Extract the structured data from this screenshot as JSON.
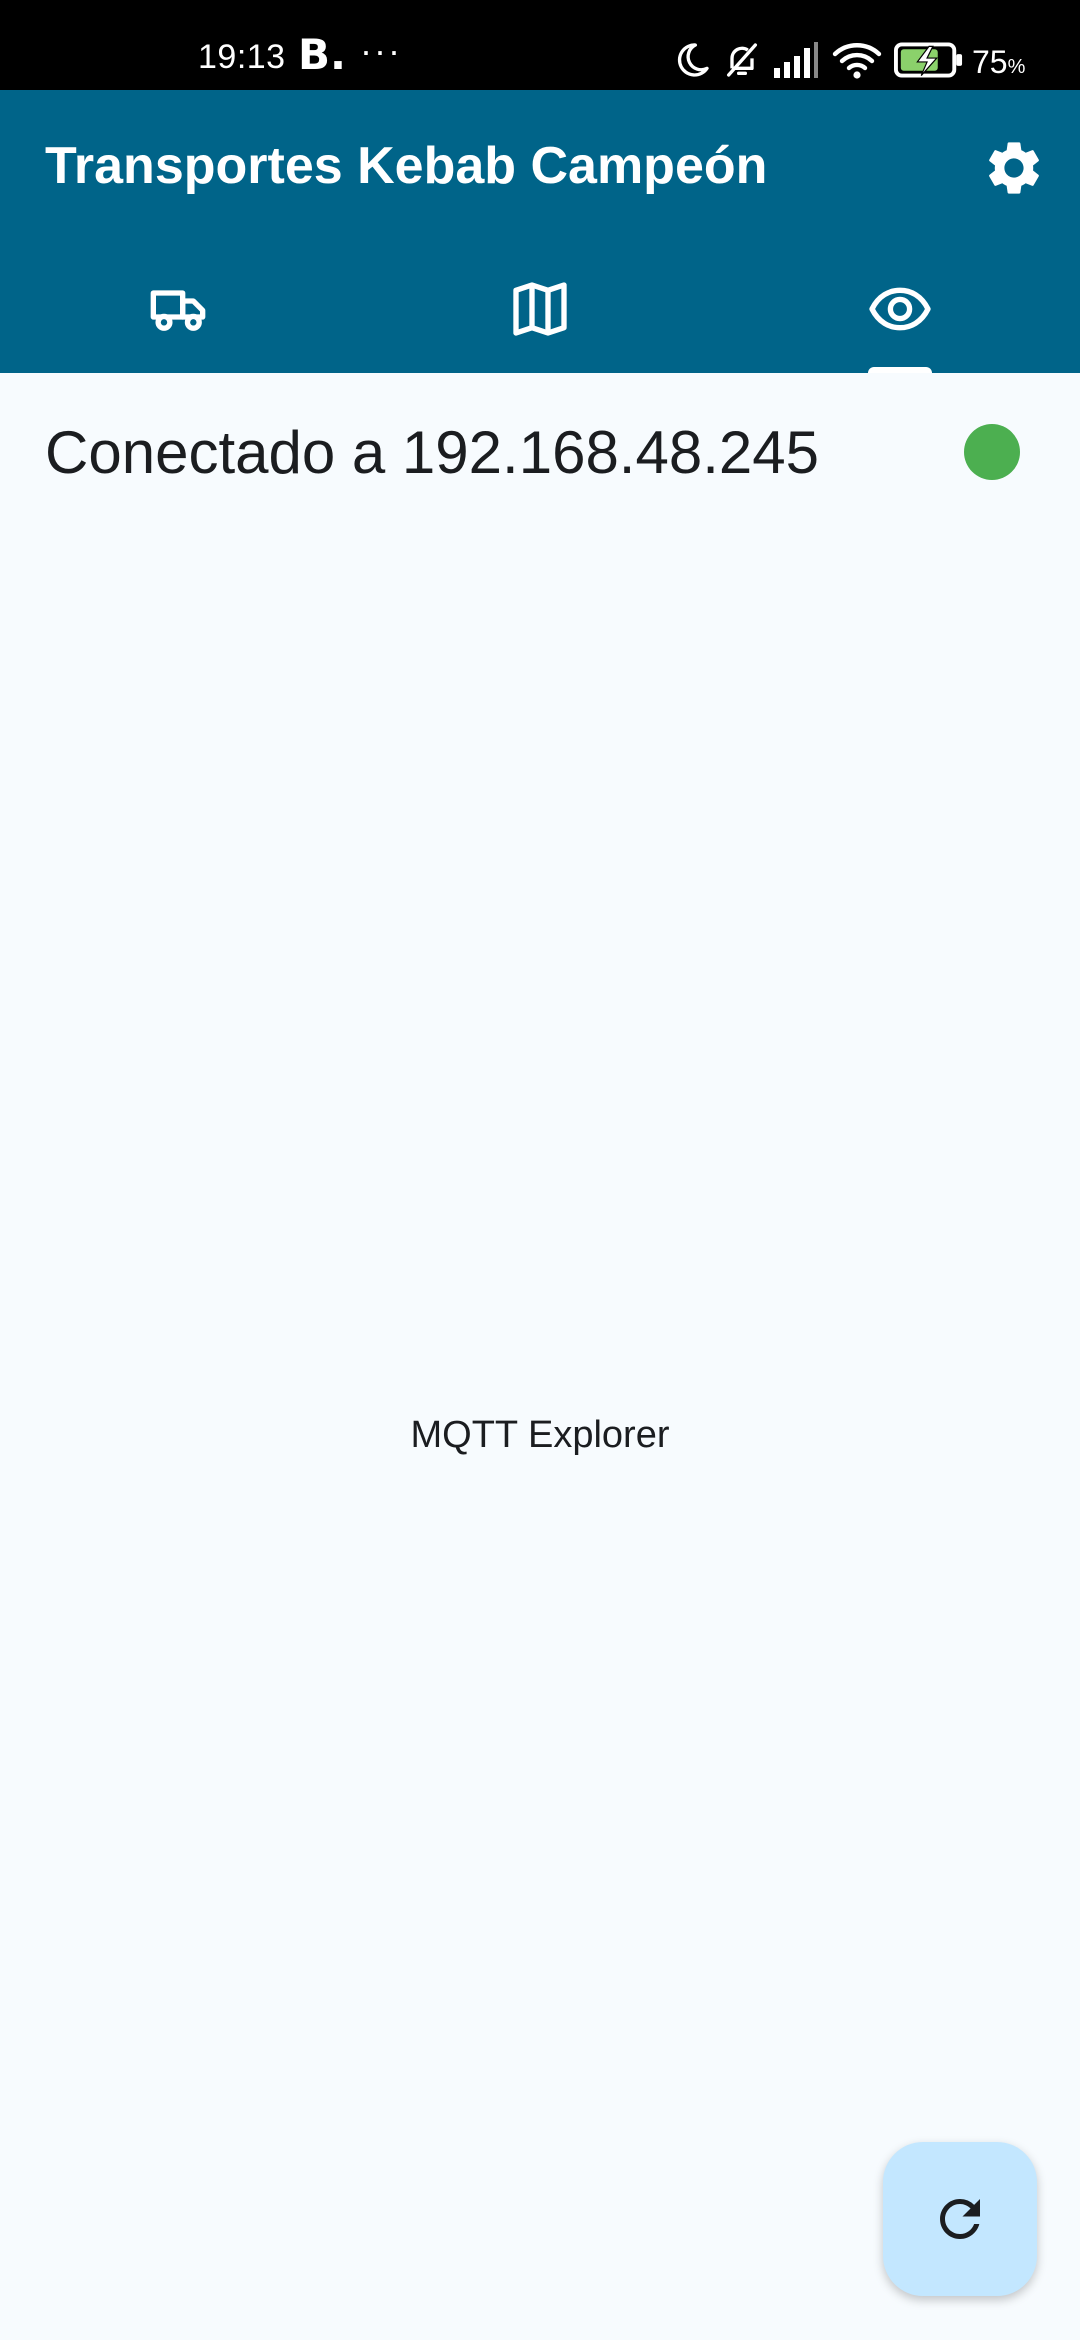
{
  "status_bar": {
    "time": "19:13",
    "notification_letter": "B.",
    "more_indicator": "···",
    "battery_percent": "75",
    "battery_unit": "%",
    "icons": [
      "moon-icon",
      "bell-off-icon",
      "signal-icon",
      "wifi-icon",
      "battery-charging-icon"
    ]
  },
  "app_bar": {
    "title": "Transportes Kebab Campeón",
    "settings_icon": "gear-icon",
    "background_color": "#006489"
  },
  "tabs": [
    {
      "icon": "truck-icon",
      "selected": false
    },
    {
      "icon": "map-icon",
      "selected": false
    },
    {
      "icon": "eye-icon",
      "selected": true
    }
  ],
  "connection": {
    "label": "Conectado a 192.168.48.245",
    "status_color": "#4caf50",
    "status": "connected"
  },
  "main": {
    "center_label": "MQTT Explorer"
  },
  "fab": {
    "icon": "refresh-icon",
    "background_color": "#c3e7ff"
  }
}
